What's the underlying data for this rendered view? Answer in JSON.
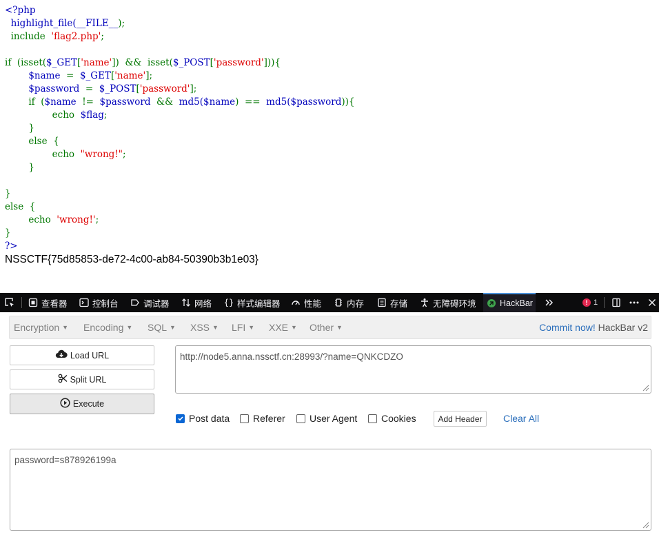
{
  "code": {
    "lines": [
      [
        {
          "t": "<?php",
          "c": "c-def"
        }
      ],
      [
        {
          "t": "  highlight_file(",
          "c": "c-def"
        },
        {
          "t": "__FILE__",
          "c": "c-def"
        },
        {
          "t": ");",
          "c": "c-key"
        }
      ],
      [
        {
          "t": "  include  ",
          "c": "c-key"
        },
        {
          "t": "'flag2.php'",
          "c": "c-str"
        },
        {
          "t": ";",
          "c": "c-key"
        }
      ],
      [],
      [
        {
          "t": "if  (",
          "c": "c-key"
        },
        {
          "t": "isset(",
          "c": "c-key"
        },
        {
          "t": "$_GET",
          "c": "c-def"
        },
        {
          "t": "[",
          "c": "c-key"
        },
        {
          "t": "'name'",
          "c": "c-str"
        },
        {
          "t": "])  &&  ",
          "c": "c-key"
        },
        {
          "t": "isset(",
          "c": "c-key"
        },
        {
          "t": "$_POST",
          "c": "c-def"
        },
        {
          "t": "[",
          "c": "c-key"
        },
        {
          "t": "'password'",
          "c": "c-str"
        },
        {
          "t": "])){",
          "c": "c-key"
        }
      ],
      [
        {
          "t": "        $name  ",
          "c": "c-def"
        },
        {
          "t": "=  ",
          "c": "c-key"
        },
        {
          "t": "$_GET",
          "c": "c-def"
        },
        {
          "t": "[",
          "c": "c-key"
        },
        {
          "t": "'name'",
          "c": "c-str"
        },
        {
          "t": "];",
          "c": "c-key"
        }
      ],
      [
        {
          "t": "        $password  ",
          "c": "c-def"
        },
        {
          "t": "=  ",
          "c": "c-key"
        },
        {
          "t": "$_POST",
          "c": "c-def"
        },
        {
          "t": "[",
          "c": "c-key"
        },
        {
          "t": "'password'",
          "c": "c-str"
        },
        {
          "t": "];",
          "c": "c-key"
        }
      ],
      [
        {
          "t": "        if  (",
          "c": "c-key"
        },
        {
          "t": "$name  ",
          "c": "c-def"
        },
        {
          "t": "!=  ",
          "c": "c-key"
        },
        {
          "t": "$password  ",
          "c": "c-def"
        },
        {
          "t": "&&  ",
          "c": "c-key"
        },
        {
          "t": "md5(",
          "c": "c-def"
        },
        {
          "t": "$name",
          "c": "c-def"
        },
        {
          "t": ")  ==  ",
          "c": "c-key"
        },
        {
          "t": "md5(",
          "c": "c-def"
        },
        {
          "t": "$password",
          "c": "c-def"
        },
        {
          "t": ")){",
          "c": "c-key"
        }
      ],
      [
        {
          "t": "                echo  ",
          "c": "c-key"
        },
        {
          "t": "$flag",
          "c": "c-def"
        },
        {
          "t": ";",
          "c": "c-key"
        }
      ],
      [
        {
          "t": "        }",
          "c": "c-key"
        }
      ],
      [
        {
          "t": "        else  {",
          "c": "c-key"
        }
      ],
      [
        {
          "t": "                echo  ",
          "c": "c-key"
        },
        {
          "t": "\"wrong!\"",
          "c": "c-str"
        },
        {
          "t": ";",
          "c": "c-key"
        }
      ],
      [
        {
          "t": "        }",
          "c": "c-key"
        }
      ],
      [],
      [
        {
          "t": "}",
          "c": "c-key"
        }
      ],
      [
        {
          "t": "else  {",
          "c": "c-key"
        }
      ],
      [
        {
          "t": "        echo  ",
          "c": "c-key"
        },
        {
          "t": "'wrong!'",
          "c": "c-str"
        },
        {
          "t": ";",
          "c": "c-key"
        }
      ],
      [
        {
          "t": "}",
          "c": "c-key"
        }
      ],
      [
        {
          "t": "?>",
          "c": "c-def"
        }
      ]
    ],
    "output": "NSSCTF{75d85853-de72-4c00-ab84-50390b3b1e03}"
  },
  "devtools": {
    "tabs": [
      {
        "label": "查看器",
        "icon": "inspector-icon"
      },
      {
        "label": "控制台",
        "icon": "console-icon"
      },
      {
        "label": "调试器",
        "icon": "debugger-icon"
      },
      {
        "label": "网络",
        "icon": "network-icon"
      },
      {
        "label": "样式编辑器",
        "icon": "style-editor-icon"
      },
      {
        "label": "性能",
        "icon": "performance-icon"
      },
      {
        "label": "内存",
        "icon": "memory-icon"
      },
      {
        "label": "存储",
        "icon": "storage-icon"
      },
      {
        "label": "无障碍环境",
        "icon": "accessibility-icon"
      },
      {
        "label": "HackBar",
        "icon": "hackbar-icon"
      }
    ],
    "active_tab": "HackBar",
    "error_count": "1",
    "colors": {
      "bar_bg": "#0c0c0d",
      "active_accent": "#4a90d9",
      "error": "#e22850"
    }
  },
  "hackbar": {
    "menu": [
      "Encryption",
      "Encoding",
      "SQL",
      "XSS",
      "LFI",
      "XXE",
      "Other"
    ],
    "commit_link": "Commit now!",
    "version": "HackBar v2",
    "buttons": {
      "load": "Load URL",
      "split": "Split URL",
      "execute": "Execute"
    },
    "url_value": "http://node5.anna.nssctf.cn:28993/?name=QNKCDZO",
    "options": [
      {
        "label": "Post data",
        "checked": true
      },
      {
        "label": "Referer",
        "checked": false
      },
      {
        "label": "User Agent",
        "checked": false
      },
      {
        "label": "Cookies",
        "checked": false
      }
    ],
    "add_header": "Add Header",
    "clear_all": "Clear All",
    "post_value": "password=s878926199a",
    "colors": {
      "link": "#2a6ebb",
      "checkbox": "#0a66d4"
    }
  }
}
